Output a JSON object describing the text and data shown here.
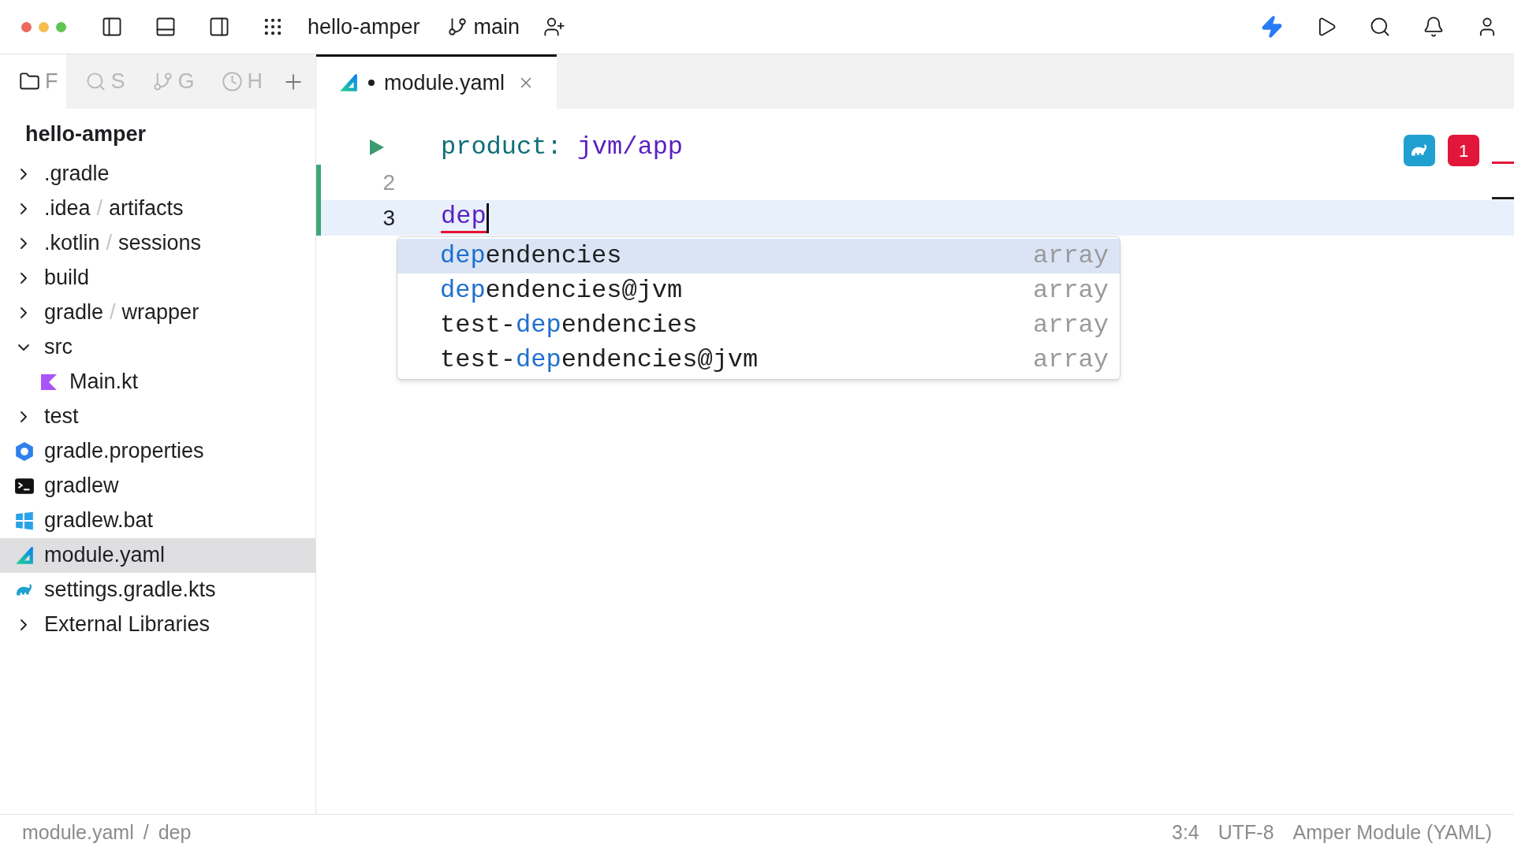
{
  "window": {
    "controls": [
      {
        "color": "#ed6a5e"
      },
      {
        "color": "#f5bf4f"
      },
      {
        "color": "#61c554"
      }
    ],
    "project": "hello-amper",
    "branch": "main"
  },
  "sidebar_tabs": [
    {
      "kind": "folder",
      "label": "F",
      "selected": true
    },
    {
      "kind": "search",
      "label": "S",
      "selected": false
    },
    {
      "kind": "branch",
      "label": "G",
      "selected": false
    },
    {
      "kind": "clock",
      "label": "H",
      "selected": false
    }
  ],
  "tree": {
    "title": "hello-amper",
    "items": [
      {
        "kind": "folder",
        "name": ".gradle",
        "expanded": false,
        "selected": false
      },
      {
        "kind": "folder",
        "name": ".idea",
        "separator": "/",
        "sub": "artifacts",
        "expanded": false,
        "selected": false
      },
      {
        "kind": "folder",
        "name": ".kotlin",
        "separator": "/",
        "sub": "sessions",
        "expanded": false,
        "selected": false
      },
      {
        "kind": "folder",
        "name": "build",
        "expanded": false,
        "selected": false
      },
      {
        "kind": "folder",
        "name": "gradle",
        "separator": "/",
        "sub": "wrapper",
        "expanded": false,
        "selected": false
      },
      {
        "kind": "folder",
        "name": "src",
        "expanded": true,
        "selected": false,
        "children": [
          {
            "kind": "kotlin",
            "name": "Main.kt",
            "selected": false
          }
        ]
      },
      {
        "kind": "folder",
        "name": "test",
        "expanded": false,
        "selected": false
      },
      {
        "kind": "properties",
        "name": "gradle.properties",
        "selected": false
      },
      {
        "kind": "shell",
        "name": "gradlew",
        "selected": false
      },
      {
        "kind": "batch",
        "name": "gradlew.bat",
        "selected": false
      },
      {
        "kind": "amper",
        "name": "module.yaml",
        "selected": true
      },
      {
        "kind": "gradle",
        "name": "settings.gradle.kts",
        "selected": false
      },
      {
        "kind": "folder",
        "name": "External Libraries",
        "expanded": false,
        "selected": false
      }
    ]
  },
  "editor_tab": {
    "label": "module.yaml",
    "modified": true,
    "selected": true
  },
  "code": [
    {
      "kind": "run",
      "key": "product:",
      "value": "jvm/app",
      "current": false
    },
    {
      "kind": "number",
      "number": "2",
      "current": false
    },
    {
      "kind": "number",
      "number": "3",
      "typed": "dep",
      "current": true
    }
  ],
  "error_count": "1",
  "completion": [
    {
      "match": "dep",
      "after": "endencies",
      "type": "array",
      "selected": true
    },
    {
      "match": "dep",
      "after": "endencies@jvm",
      "type": "array",
      "selected": false
    },
    {
      "before": "test-",
      "match": "dep",
      "after": "endencies",
      "type": "array",
      "selected": false
    },
    {
      "before": "test-",
      "match": "dep",
      "after": "endencies@jvm",
      "type": "array",
      "selected": false
    }
  ],
  "status_bar": {
    "breadcrumbs": [
      "module.yaml",
      "dep"
    ],
    "separator": "/",
    "position": "3:4",
    "encoding": "UTF-8",
    "file_type": "Amper Module (YAML)"
  }
}
